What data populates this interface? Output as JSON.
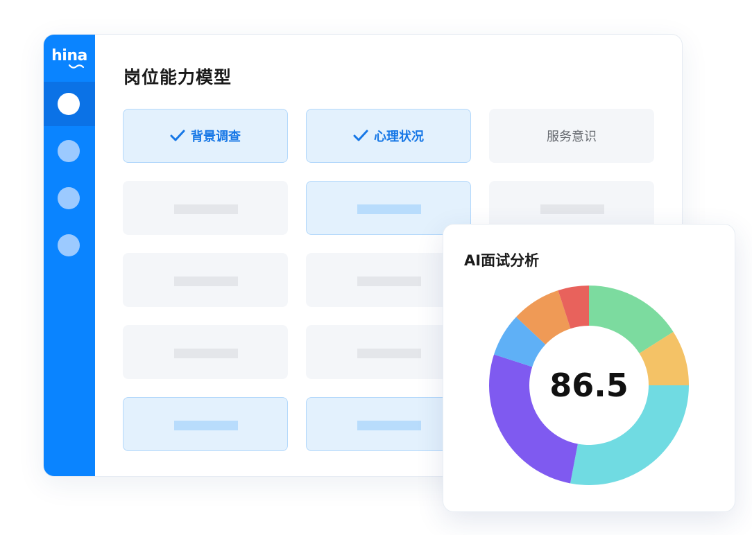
{
  "sidebar": {
    "logo": "hina",
    "items": [
      {
        "name": "nav-item-1",
        "active": true
      },
      {
        "name": "nav-item-2",
        "active": false
      },
      {
        "name": "nav-item-3",
        "active": false
      },
      {
        "name": "nav-item-4",
        "active": false
      }
    ]
  },
  "main": {
    "title": "岗位能力模型",
    "cards": [
      {
        "label": "背景调查",
        "selected": true,
        "checked": true
      },
      {
        "label": "心理状况",
        "selected": true,
        "checked": true
      },
      {
        "label": "服务意识",
        "selected": false,
        "checked": false
      }
    ]
  },
  "analysis": {
    "title": "AI面试分析",
    "score": "86.5"
  },
  "colors": {
    "brand": "#0a84ff",
    "selected_bg": "#e3f1fd",
    "selected_text": "#1677e6"
  },
  "chart_data": {
    "type": "pie",
    "donut": true,
    "center_label": "86.5",
    "values": [
      16,
      9,
      28,
      27,
      7,
      8,
      5
    ],
    "colors": [
      "#7cdb9f",
      "#f4c266",
      "#70dbe2",
      "#7f5af0",
      "#5fb0f6",
      "#ef9a56",
      "#e8625c"
    ],
    "start_angle_deg": 0,
    "direction": "clockwise"
  }
}
